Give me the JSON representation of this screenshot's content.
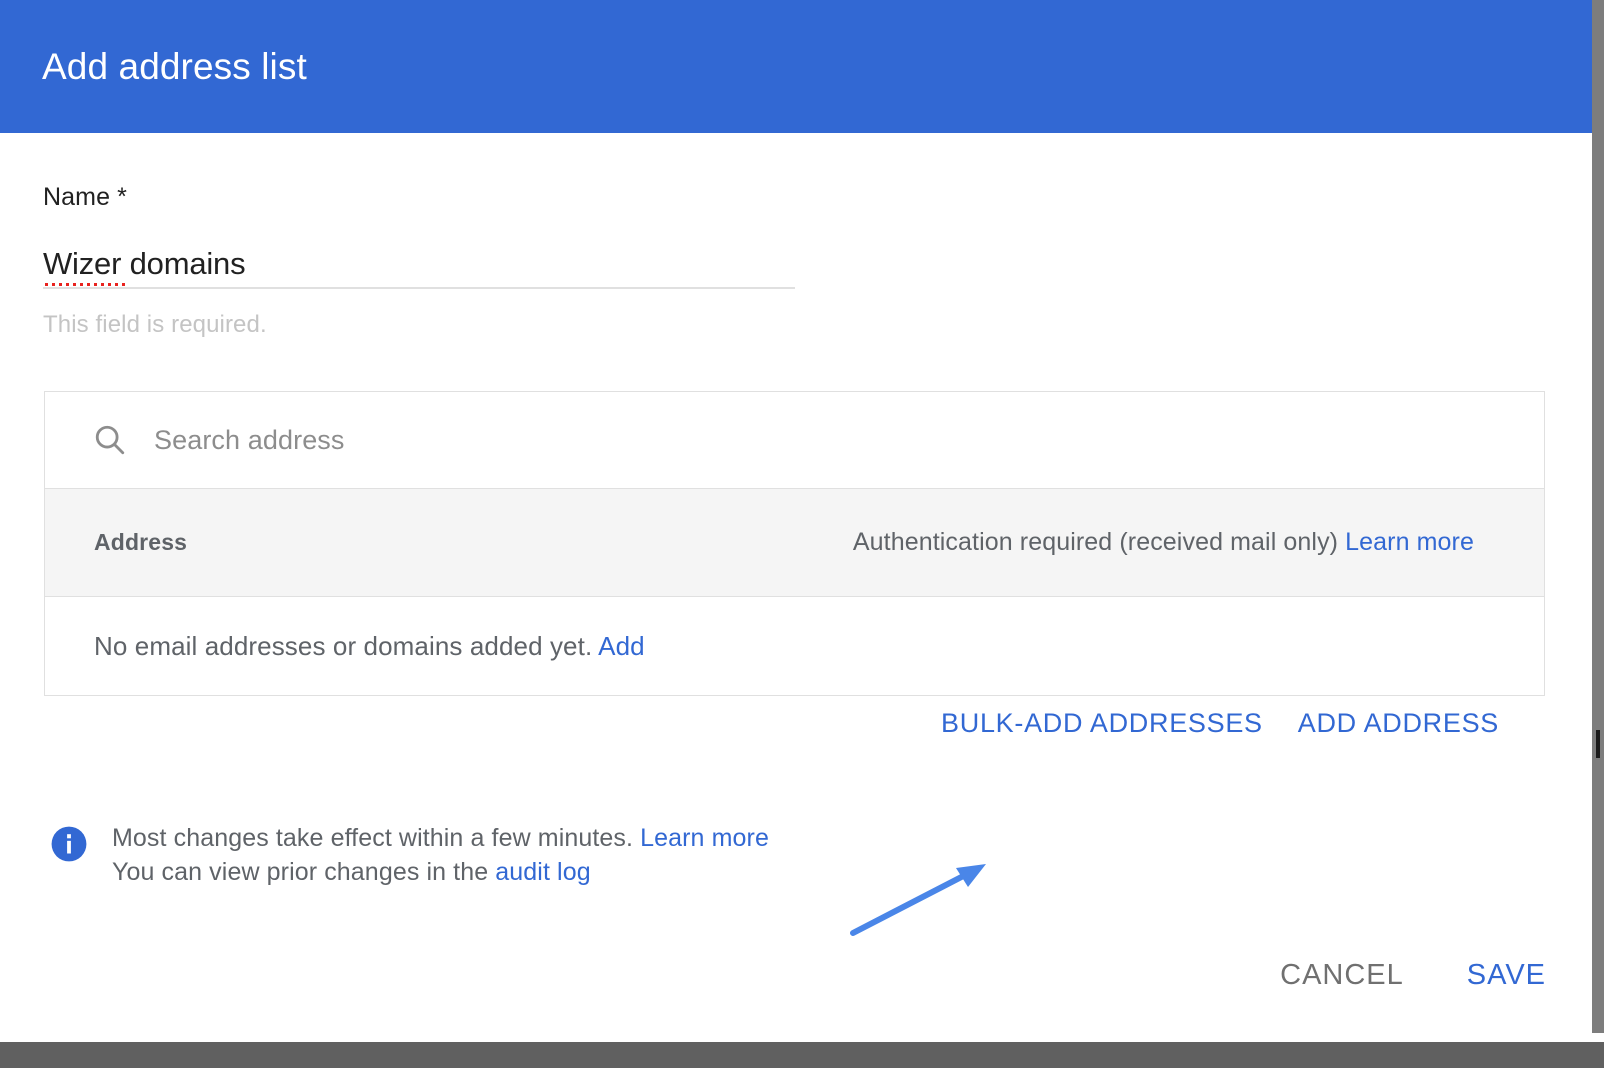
{
  "dialog": {
    "title": "Add address list",
    "header_color": "#3268d3"
  },
  "name_field": {
    "label": "Name *",
    "value": "Wizer domains",
    "helper_text": "This field is required.",
    "spellcheck_word": "Wizer"
  },
  "search": {
    "placeholder": "Search address",
    "value": "",
    "icon": "search-icon"
  },
  "table": {
    "columns": {
      "address": "Address",
      "authentication": "Authentication required (received mail only)",
      "authentication_link": "Learn more"
    },
    "empty_state": {
      "text": "No email addresses or domains added yet.",
      "link": "Add"
    },
    "rows": []
  },
  "table_actions": {
    "bulk_add": "BULK-ADD ADDRESSES",
    "add_address": "ADD ADDRESS"
  },
  "annotation": {
    "type": "arrow",
    "points_to": "BULK-ADD ADDRESSES",
    "color": "#4a86e8"
  },
  "info_note": {
    "icon": "info-icon",
    "line1_text": "Most changes take effect within a few minutes.",
    "line1_link": "Learn more",
    "line2_text": "You can view prior changes in the",
    "line2_link": "audit log"
  },
  "footer": {
    "cancel": "CANCEL",
    "save": "SAVE"
  },
  "colors": {
    "brand_blue": "#3268d3",
    "link_blue": "#3268d3",
    "annotation_blue": "#4a86e8",
    "header_row_bg": "#f5f5f5",
    "border": "#e0e0e0",
    "muted_text": "#5f6368",
    "helper_text": "#c4c4c4",
    "spellcheck_red": "#e8221e"
  }
}
